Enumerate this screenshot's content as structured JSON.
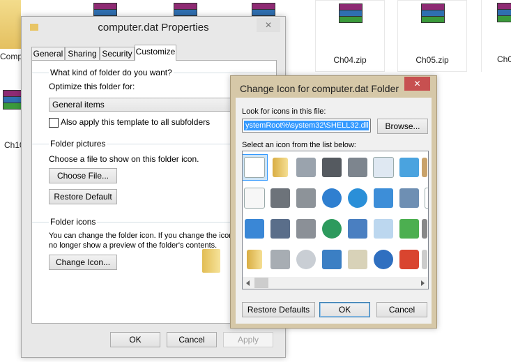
{
  "background_files": [
    {
      "label": "Compu"
    },
    {
      "label": ""
    },
    {
      "label": ""
    },
    {
      "label": ""
    },
    {
      "label": "Ch04.zip"
    },
    {
      "label": "Ch05.zip"
    },
    {
      "label": "Ch0"
    },
    {
      "label": "Ch10"
    }
  ],
  "properties_dialog": {
    "title": "computer.dat Properties",
    "tabs": [
      "General",
      "Sharing",
      "Security",
      "Customize"
    ],
    "active_tab": "Customize",
    "folder_type": {
      "heading": "What kind of folder do you want?",
      "optimize_label": "Optimize this folder for:",
      "optimize_value": "General items",
      "template_checkbox_label": "Also apply this template to all subfolders"
    },
    "folder_pictures": {
      "heading": "Folder pictures",
      "description": "Choose a file to show on this folder icon.",
      "choose_file_button": "Choose File...",
      "restore_default_button": "Restore Default"
    },
    "folder_icons": {
      "heading": "Folder icons",
      "description_line1": "You can change the folder icon. If you change the icon,",
      "description_line2": "no longer show a preview of the folder's contents.",
      "change_icon_button": "Change Icon..."
    },
    "buttons": {
      "ok": "OK",
      "cancel": "Cancel",
      "apply": "Apply"
    }
  },
  "change_icon_dialog": {
    "title": "Change Icon for computer.dat Folder",
    "look_for_label": "Look for icons in this file:",
    "file_path_value": "ystemRoot%\\system32\\SHELL32.dll",
    "browse_button": "Browse...",
    "select_label": "Select an icon from the list below:",
    "icons": [
      "document-icon",
      "folder-icon",
      "drive-icon",
      "chip-icon",
      "printer-icon",
      "clock-document-icon",
      "monitor-icon",
      "partial-icon",
      "text-document-icon",
      "network-drive-icon",
      "network-server-icon",
      "globe-icon",
      "globe-network-icon",
      "control-panel-icon",
      "shell-icon",
      "shortcut-icon",
      "window-icon",
      "floppy-icon",
      "disconnected-drive-icon",
      "globe-cursor-icon",
      "network-icon",
      "search-icon",
      "recycle-arrow-icon",
      "partial-icon-2",
      "folder-icon-2",
      "removable-drive-icon",
      "cd-drive-icon",
      "desktop-monitor-icon",
      "calculator-icon",
      "help-icon",
      "power-icon",
      "partial-icon-3"
    ],
    "buttons": {
      "restore_defaults": "Restore Defaults",
      "ok": "OK",
      "cancel": "Cancel"
    },
    "close_glyph": "✕"
  },
  "colors": {
    "accent": "#3399ff",
    "close_red": "#c75050",
    "dialog_frame": "#d6c8a8",
    "window_frame": "#e8e8e8"
  }
}
